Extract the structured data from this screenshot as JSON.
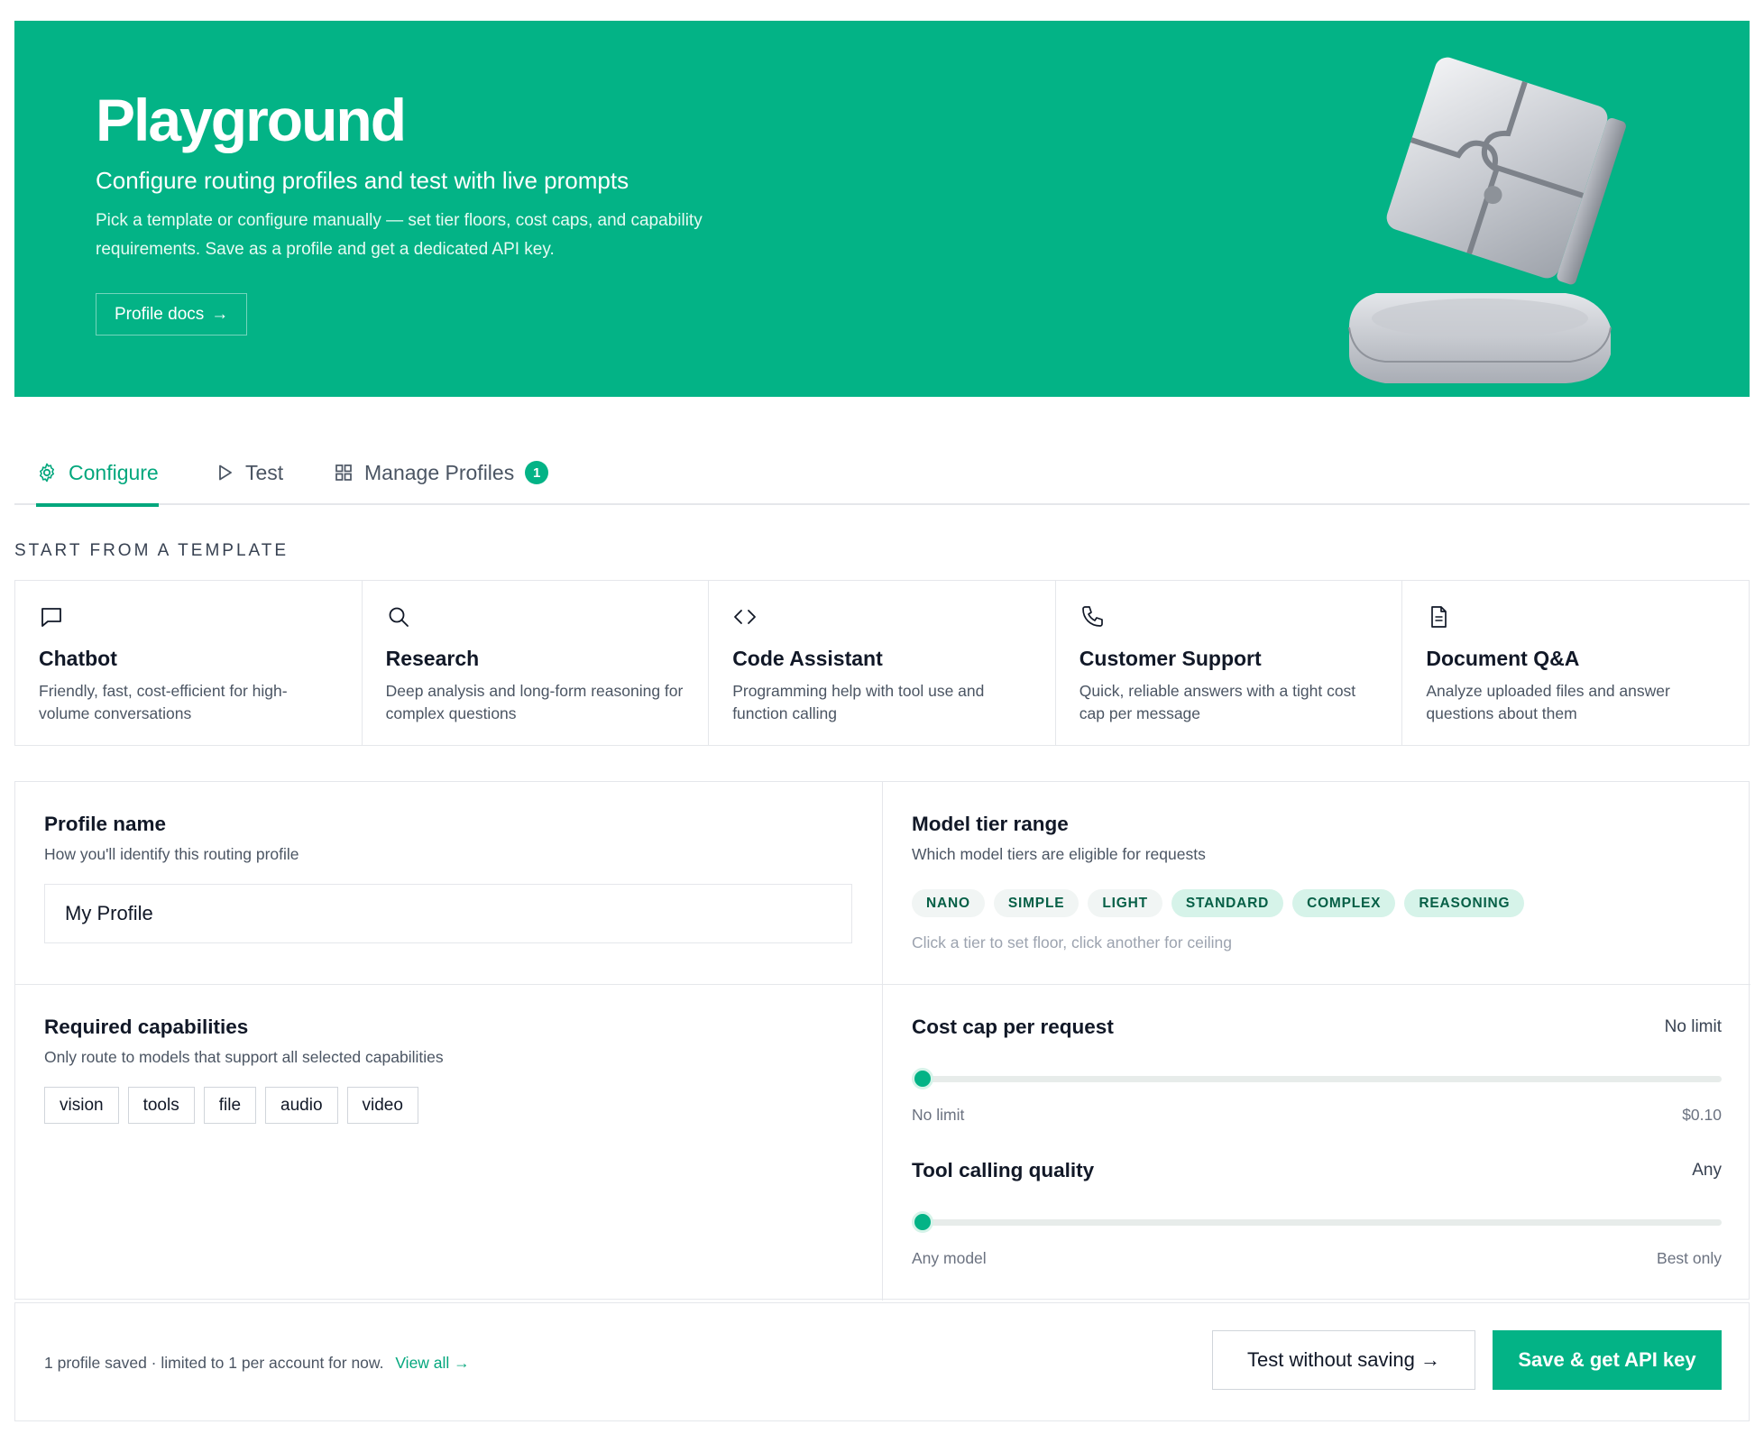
{
  "hero": {
    "title": "Playground",
    "subtitle": "Configure routing profiles and test with live prompts",
    "description": "Pick a template or configure manually — set tier floors, cost caps, and capability requirements. Save as a profile and get a dedicated API key.",
    "docs_label": "Profile docs",
    "docs_arrow": "→",
    "illustration": "metal-puzzle-cube-illustration"
  },
  "tabs": [
    {
      "label": "Configure",
      "icon": "gear-icon",
      "active": true
    },
    {
      "label": "Test",
      "icon": "play-icon",
      "active": false
    },
    {
      "label": "Manage Profiles",
      "icon": "grid-icon",
      "active": false,
      "badge": "1"
    }
  ],
  "templates": {
    "heading": "START FROM A TEMPLATE",
    "items": [
      {
        "icon": "chat-bubble-icon",
        "title": "Chatbot",
        "desc": "Friendly, fast, cost-efficient for high-volume conversations"
      },
      {
        "icon": "search-icon",
        "title": "Research",
        "desc": "Deep analysis and long-form reasoning for complex questions"
      },
      {
        "icon": "code-icon",
        "title": "Code Assistant",
        "desc": "Programming help with tool use and function calling"
      },
      {
        "icon": "phone-icon",
        "title": "Customer Support",
        "desc": "Quick, reliable answers with a tight cost cap per message"
      },
      {
        "icon": "document-icon",
        "title": "Document Q&A",
        "desc": "Analyze uploaded files and answer questions about them"
      }
    ]
  },
  "profile_name": {
    "title": "Profile name",
    "desc": "How you'll identify this routing profile",
    "value": "My Profile"
  },
  "tier_range": {
    "title": "Model tier range",
    "desc": "Which model tiers are eligible for requests",
    "tiers": [
      "NANO",
      "SIMPLE",
      "LIGHT",
      "STANDARD",
      "COMPLEX",
      "REASONING"
    ],
    "hint": "Click a tier to set floor, click another for ceiling"
  },
  "capabilities": {
    "title": "Required capabilities",
    "desc": "Only route to models that support all selected capabilities",
    "items": [
      "vision",
      "tools",
      "file",
      "audio",
      "video"
    ]
  },
  "cost_cap": {
    "title": "Cost cap per request",
    "value": "No limit",
    "min_label": "No limit",
    "max_label": "$0.10",
    "level": 0
  },
  "tool_quality": {
    "title": "Tool calling quality",
    "value": "Any",
    "min_label": "Any model",
    "max_label": "Best only",
    "level": 0
  },
  "footer": {
    "note": "1 profile saved · limited to 1 per account for now.",
    "view_all": "View all →",
    "test_label": "Test without saving →",
    "save_label": "Save & get API key"
  },
  "colors": {
    "brand": "#03b386",
    "brand_dark": "#03a77d",
    "tier_text": "#065f46"
  }
}
